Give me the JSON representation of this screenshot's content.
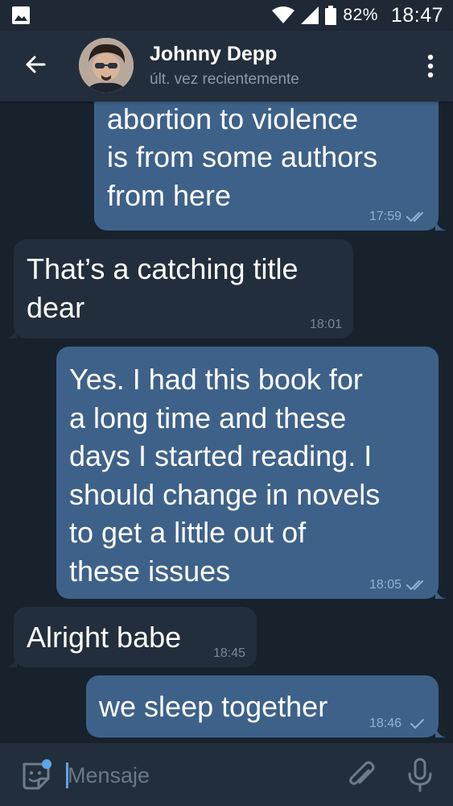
{
  "status_bar": {
    "battery_percent": "82%",
    "time": "18:47"
  },
  "header": {
    "contact_name": "Johnny Depp",
    "last_seen": "últ. vez recientemente"
  },
  "messages": [
    {
      "direction": "out",
      "text": "supports\nabortion to violence\nis from some authors\nfrom here",
      "time": "17:59",
      "status": "read"
    },
    {
      "direction": "in",
      "text": "That’s a catching title\ndear",
      "time": "18:01"
    },
    {
      "direction": "out",
      "text": "Yes. I had this book for\na long time and these\ndays I started reading. I\nshould change in novels\nto get a little out of\nthese issues",
      "time": "18:05",
      "status": "read"
    },
    {
      "direction": "in",
      "text": "Alright babe",
      "time": "18:45"
    },
    {
      "direction": "out",
      "text": "we sleep together",
      "time": "18:46",
      "status": "sent"
    }
  ],
  "input": {
    "placeholder": "Mensaje"
  },
  "icons": {
    "back": "arrow-left-icon",
    "menu": "more-vertical-icon",
    "emoji": "sticker-emoji-icon",
    "attach": "paperclip-icon",
    "mic": "microphone-icon",
    "read": "double-check-icon",
    "sent": "single-check-icon"
  },
  "colors": {
    "background": "#18222d",
    "header": "#232e3c",
    "outgoing_bubble": "#3e6189",
    "incoming_bubble": "#232e3c",
    "accent": "#5ea5e6"
  }
}
